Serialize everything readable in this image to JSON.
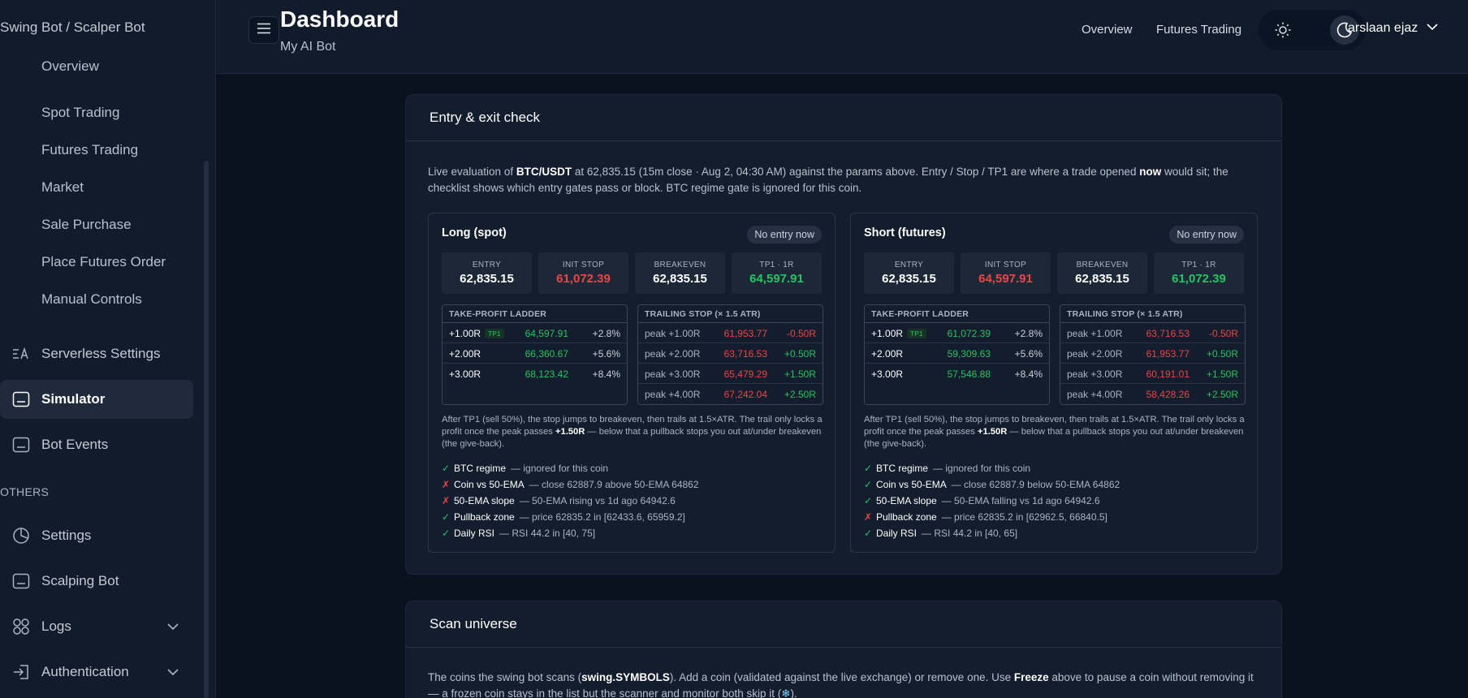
{
  "brand": "Swing Bot / Scalper Bot",
  "sidebar": {
    "sub_items": [
      "Overview",
      "Spot Trading",
      "Futures Trading",
      "Market",
      "Sale Purchase",
      "Place Futures Order",
      "Manual Controls"
    ],
    "serverless": "Serverless Settings",
    "simulator": "Simulator",
    "bot_events": "Bot Events",
    "section_others": "OTHERS",
    "settings": "Settings",
    "scalping_bot": "Scalping Bot",
    "logs": "Logs",
    "authentication": "Authentication"
  },
  "header": {
    "title": "Dashboard",
    "subtitle": "My AI Bot",
    "link_overview": "Overview",
    "link_futures": "Futures Trading",
    "user": "arslaan ejaz"
  },
  "entry_card": {
    "title": "Entry & exit check",
    "desc": {
      "t1": "Live evaluation of ",
      "pair": "BTC/USDT",
      "t2": " at 62,835.15 (15m close · Aug 2, 04:30 AM) against the params above. Entry / Stop / TP1 are where a trade opened ",
      "now": "now",
      "t3": " would sit; the checklist shows which entry gates pass or block. BTC regime gate is ignored for this coin."
    },
    "labels": {
      "entry": "ENTRY",
      "init_stop": "INIT STOP",
      "breakeven": "BREAKEVEN",
      "tp1": "TP1 · 1R",
      "ladder": "TAKE-PROFIT LADDER",
      "trailing": "TRAILING STOP (× 1.5 ATR)",
      "tp1_tag": "TP1"
    },
    "note": {
      "t1": "After TP1 (sell 50%), the stop jumps to breakeven, then trails at 1.5×ATR. The trail only locks a profit once the peak passes ",
      "b": "+1.50R",
      "t2": " — below that a pullback stops you out at/under breakeven (the give-back)."
    },
    "long": {
      "title": "Long (spot)",
      "badge": "No entry now",
      "entry": "62,835.15",
      "init_stop": "61,072.39",
      "breakeven": "62,835.15",
      "tp1": "64,597.91",
      "ladder": [
        {
          "r": "+1.00R",
          "price": "64,597.91",
          "pct": "+2.8%"
        },
        {
          "r": "+2.00R",
          "price": "66,360.67",
          "pct": "+5.6%"
        },
        {
          "r": "+3.00R",
          "price": "68,123.42",
          "pct": "+8.4%"
        }
      ],
      "trail": [
        {
          "peak": "peak +1.00R",
          "price": "61,953.77",
          "r": "-0.50R"
        },
        {
          "peak": "peak +2.00R",
          "price": "63,716.53",
          "r": "+0.50R"
        },
        {
          "peak": "peak +3.00R",
          "price": "65,479.29",
          "r": "+1.50R"
        },
        {
          "peak": "peak +4.00R",
          "price": "67,242.04",
          "r": "+2.50R"
        }
      ],
      "checks": [
        {
          "mark": "✓",
          "name": "BTC regime",
          "detail": "— ignored for this coin"
        },
        {
          "mark": "✗",
          "name": "Coin vs 50-EMA",
          "detail": "— close 62887.9 above 50-EMA 64862"
        },
        {
          "mark": "✗",
          "name": "50-EMA slope",
          "detail": "— 50-EMA rising vs 1d ago 64942.6"
        },
        {
          "mark": "✓",
          "name": "Pullback zone",
          "detail": "— price 62835.2 in [62433.6, 65959.2]"
        },
        {
          "mark": "✓",
          "name": "Daily RSI",
          "detail": "— RSI 44.2 in [40, 75]"
        }
      ]
    },
    "short": {
      "title": "Short (futures)",
      "badge": "No entry now",
      "entry": "62,835.15",
      "init_stop": "64,597.91",
      "breakeven": "62,835.15",
      "tp1": "61,072.39",
      "ladder": [
        {
          "r": "+1.00R",
          "price": "61,072.39",
          "pct": "+2.8%"
        },
        {
          "r": "+2.00R",
          "price": "59,309.63",
          "pct": "+5.6%"
        },
        {
          "r": "+3.00R",
          "price": "57,546.88",
          "pct": "+8.4%"
        }
      ],
      "trail": [
        {
          "peak": "peak +1.00R",
          "price": "63,716.53",
          "r": "-0.50R"
        },
        {
          "peak": "peak +2.00R",
          "price": "61,953.77",
          "r": "+0.50R"
        },
        {
          "peak": "peak +3.00R",
          "price": "60,191.01",
          "r": "+1.50R"
        },
        {
          "peak": "peak +4.00R",
          "price": "58,428.26",
          "r": "+2.50R"
        }
      ],
      "checks": [
        {
          "mark": "✓",
          "name": "BTC regime",
          "detail": "— ignored for this coin"
        },
        {
          "mark": "✓",
          "name": "Coin vs 50-EMA",
          "detail": "— close 62887.9 below 50-EMA 64862"
        },
        {
          "mark": "✓",
          "name": "50-EMA slope",
          "detail": "— 50-EMA falling vs 1d ago 64942.6"
        },
        {
          "mark": "✗",
          "name": "Pullback zone",
          "detail": "— price 62835.2 in [62962.5, 66840.5]"
        },
        {
          "mark": "✓",
          "name": "Daily RSI",
          "detail": "— RSI 44.2 in [40, 65]"
        }
      ]
    }
  },
  "scan_card": {
    "title": "Scan universe",
    "t1": "The coins the swing bot scans (",
    "code": "swing.SYMBOLS",
    "t2": "). Add a coin (validated against the live exchange) or remove one. Use ",
    "freeze": "Freeze",
    "t3": " above to pause a coin without removing it — a frozen coin stays in the list but the scanner and monitor both skip it (",
    "snow": "❄",
    "t4": ")."
  },
  "colors": {
    "positive": "#22c55e",
    "negative": "#ef4444",
    "background": "#0a1220",
    "panel": "#131d2d"
  },
  "icons": [
    "menu-icon",
    "sun-icon",
    "moon-icon",
    "chevron-down-icon",
    "serverless-icon",
    "simulator-icon",
    "bot-events-icon",
    "settings-icon",
    "scalping-bot-icon",
    "logs-icon",
    "authentication-icon"
  ]
}
